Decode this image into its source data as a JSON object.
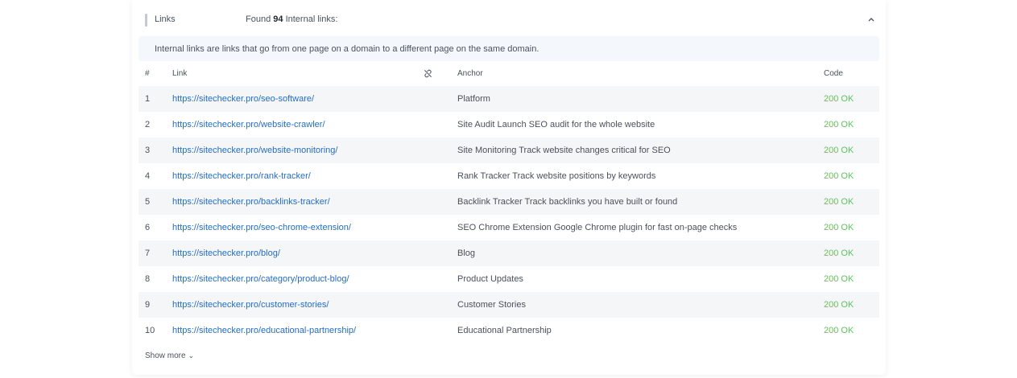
{
  "header": {
    "title": "Links",
    "found_prefix": "Found",
    "found_count": "94",
    "found_suffix": "Internal links:"
  },
  "info_text": "Internal links are links that go from one page on a domain to a different page on the same domain.",
  "table": {
    "columns": {
      "num": "#",
      "link": "Link",
      "link_icon": "unlink-icon",
      "anchor": "Anchor",
      "code": "Code"
    },
    "rows": [
      {
        "num": "1",
        "link": "https://sitechecker.pro/seo-software/",
        "anchor": "Platform",
        "code": "200 OK"
      },
      {
        "num": "2",
        "link": "https://sitechecker.pro/website-crawler/",
        "anchor": "Site Audit Launch SEO audit for the whole website",
        "code": "200 OK"
      },
      {
        "num": "3",
        "link": "https://sitechecker.pro/website-monitoring/",
        "anchor": "Site Monitoring Track website changes critical for SEO",
        "code": "200 OK"
      },
      {
        "num": "4",
        "link": "https://sitechecker.pro/rank-tracker/",
        "anchor": "Rank Tracker Track website positions by keywords",
        "code": "200 OK"
      },
      {
        "num": "5",
        "link": "https://sitechecker.pro/backlinks-tracker/",
        "anchor": "Backlink Tracker Track backlinks you have built or found",
        "code": "200 OK"
      },
      {
        "num": "6",
        "link": "https://sitechecker.pro/seo-chrome-extension/",
        "anchor": "SEO Chrome Extension Google Chrome plugin for fast on-page checks",
        "code": "200 OK"
      },
      {
        "num": "7",
        "link": "https://sitechecker.pro/blog/",
        "anchor": "Blog",
        "code": "200 OK"
      },
      {
        "num": "8",
        "link": "https://sitechecker.pro/category/product-blog/",
        "anchor": "Product Updates",
        "code": "200 OK"
      },
      {
        "num": "9",
        "link": "https://sitechecker.pro/customer-stories/",
        "anchor": "Customer Stories",
        "code": "200 OK"
      },
      {
        "num": "10",
        "link": "https://sitechecker.pro/educational-partnership/",
        "anchor": "Educational Partnership",
        "code": "200 OK"
      }
    ]
  },
  "show_more": "Show more",
  "colors": {
    "link": "#2b6cb5",
    "status_ok": "#5cc45c",
    "info_bg": "#f4f7fb",
    "row_alt_bg": "#f5f6f8"
  }
}
